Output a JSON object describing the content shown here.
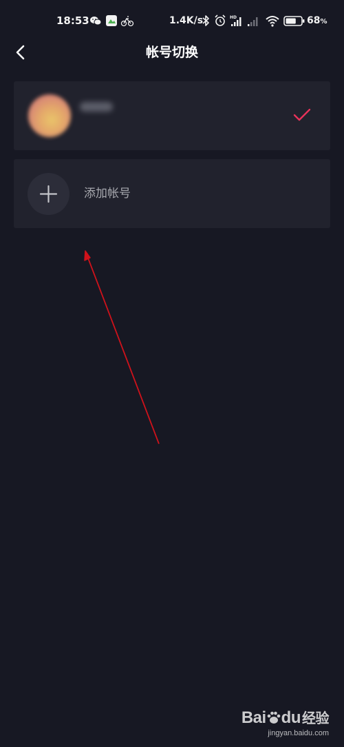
{
  "status_bar": {
    "time": "18:53",
    "network_speed": "1.4K/s",
    "battery_percent": "68",
    "battery_unit": "%",
    "battery_level": 0.68,
    "icons": [
      "wechat-icon",
      "app-icon",
      "bike-app-icon",
      "bluetooth-icon",
      "alarm-icon",
      "signal-hd-icon",
      "signal-icon",
      "wifi-icon",
      "battery-icon"
    ]
  },
  "header": {
    "title": "帐号切换",
    "back_icon": "chevron-left-icon"
  },
  "accounts": {
    "current": {
      "avatar": "blurred-avatar",
      "selected": true,
      "check_icon": "checkmark-icon"
    },
    "add": {
      "label": "添加帐号",
      "icon": "plus-icon"
    }
  },
  "colors": {
    "background": "#171823",
    "card": "#21222d",
    "accent_check": "#e8325a",
    "annotation": "#d0121b"
  },
  "watermark": {
    "brand_latin": "Bai",
    "brand_latin_2": "du",
    "brand_cn": "经验",
    "url": "jingyan.baidu.com"
  }
}
